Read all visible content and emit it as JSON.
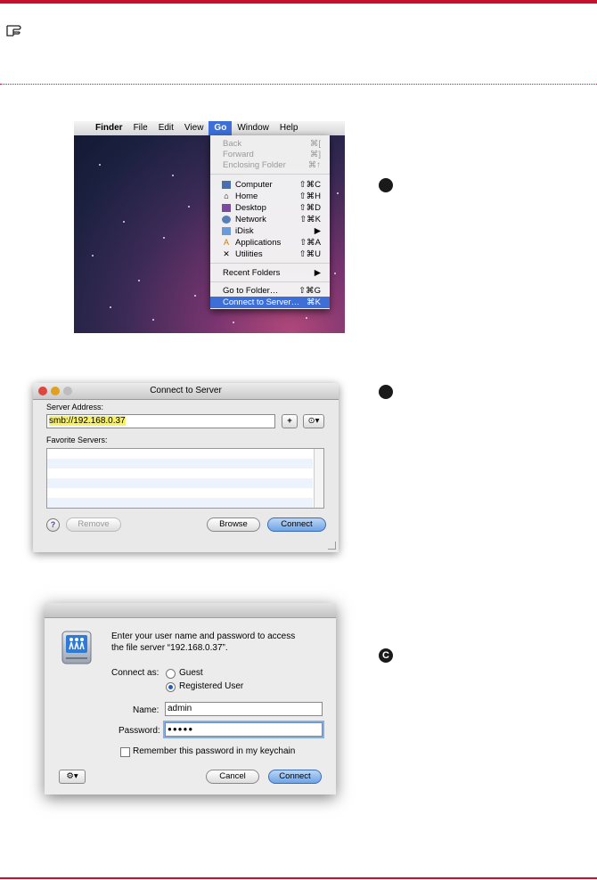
{
  "step_labels": [
    "",
    "",
    "C"
  ],
  "screenshot1": {
    "menubar": {
      "apple": "",
      "items": [
        "Finder",
        "File",
        "Edit",
        "View",
        "Go",
        "Window",
        "Help"
      ]
    },
    "go_menu": {
      "items": [
        {
          "label": "Back",
          "shortcut": "⌘[",
          "disabled": true,
          "icon": ""
        },
        {
          "label": "Forward",
          "shortcut": "⌘]",
          "disabled": true,
          "icon": ""
        },
        {
          "label": "Enclosing Folder",
          "shortcut": "⌘↑",
          "disabled": true,
          "icon": ""
        },
        {
          "label": "Computer",
          "shortcut": "⇧⌘C",
          "icon": "computer-icon"
        },
        {
          "label": "Home",
          "shortcut": "⇧⌘H",
          "icon": "home-icon"
        },
        {
          "label": "Desktop",
          "shortcut": "⇧⌘D",
          "icon": "desktop-icon"
        },
        {
          "label": "Network",
          "shortcut": "⇧⌘K",
          "icon": "network-icon"
        },
        {
          "label": "iDisk",
          "shortcut": "▶",
          "icon": "idisk-icon"
        },
        {
          "label": "Applications",
          "shortcut": "⇧⌘A",
          "icon": "applications-icon"
        },
        {
          "label": "Utilities",
          "shortcut": "⇧⌘U",
          "icon": "utilities-icon"
        },
        {
          "label": "Recent Folders",
          "shortcut": "▶",
          "icon": ""
        },
        {
          "label": "Go to Folder…",
          "shortcut": "⇧⌘G",
          "icon": ""
        },
        {
          "label": "Connect to Server…",
          "shortcut": "⌘K",
          "highlighted": true,
          "icon": ""
        }
      ]
    }
  },
  "screenshot2": {
    "title": "Connect to Server",
    "server_address_label": "Server Address:",
    "server_address_value": "smb://192.168.0.37",
    "add_button": "+",
    "recent_button": "⊙▾",
    "favorite_servers_label": "Favorite Servers:",
    "help_button": "?",
    "remove_button": "Remove",
    "browse_button": "Browse",
    "connect_button": "Connect"
  },
  "screenshot3": {
    "prompt_line1": "Enter your user name and password to access",
    "prompt_line2": "the file server “192.168.0.37”.",
    "connect_as_label": "Connect as:",
    "guest_label": "Guest",
    "registered_label": "Registered User",
    "name_label": "Name:",
    "name_value": "admin",
    "password_label": "Password:",
    "password_value": "●●●●●",
    "remember_label": "Remember this password in my keychain",
    "gear_button": "⚙▾",
    "cancel_button": "Cancel",
    "connect_button": "Connect"
  },
  "colors": {
    "accent": "#c8102e",
    "selection": "#3d6fd6",
    "field_highlight": "#f7f06a"
  }
}
